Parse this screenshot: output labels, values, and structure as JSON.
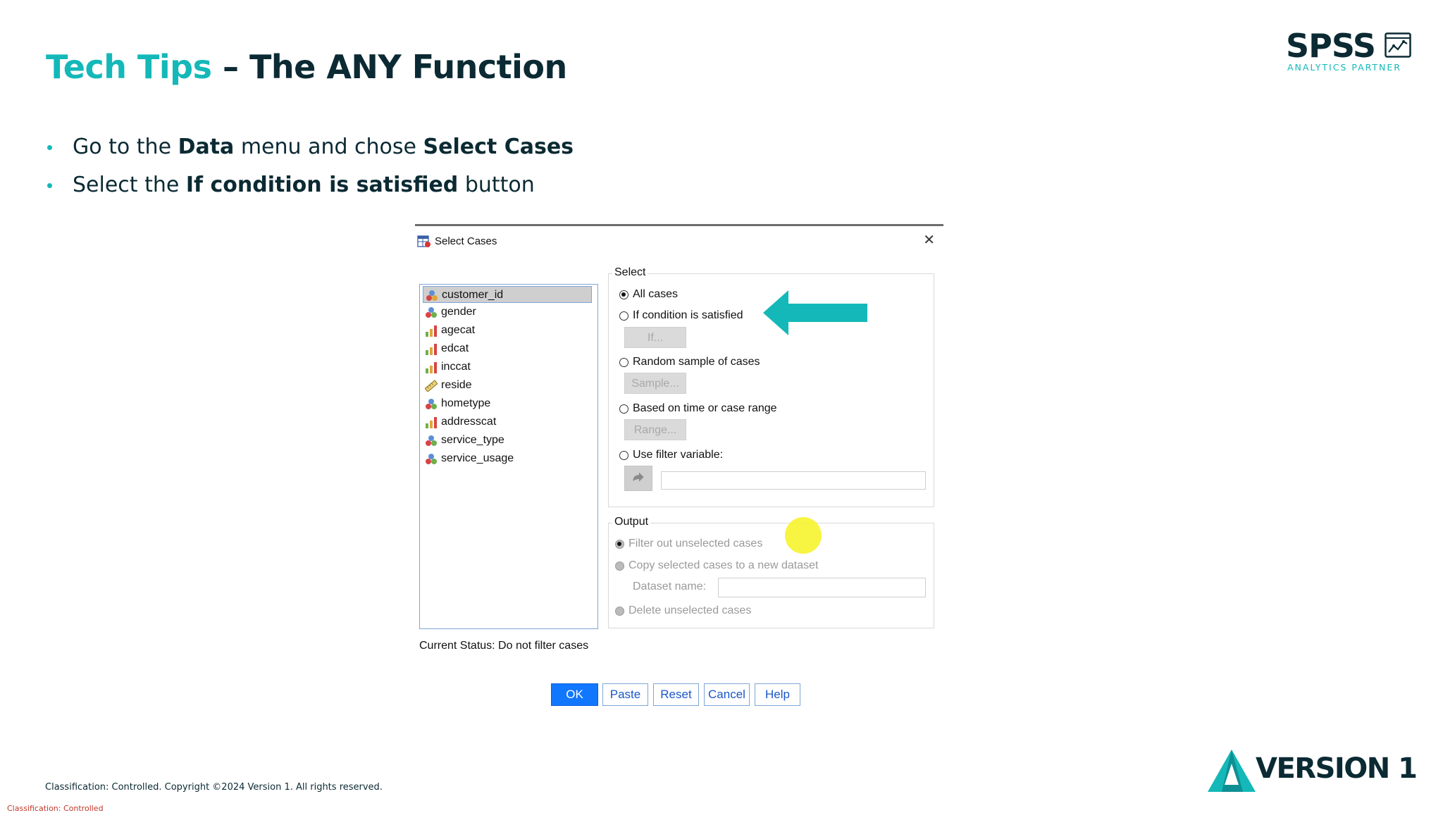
{
  "slide": {
    "title_accent": "Tech Tips",
    "title_rest": " – The ANY Function",
    "bullets": [
      {
        "pre": "Go to the ",
        "b1": "Data",
        "mid": " menu and chose ",
        "b2": "Select Cases",
        "post": ""
      },
      {
        "pre": "Select the ",
        "b1": "If condition is satisfied",
        "mid": " button",
        "b2": "",
        "post": ""
      }
    ],
    "footer": "Classification: Controlled. Copyright ©2024 Version 1. All rights reserved.",
    "classification": "Classification: Controlled",
    "colors": {
      "accent": "#14b8b8",
      "dark": "#0b2a33",
      "highlight": "#f7f221"
    }
  },
  "logos": {
    "spss": {
      "word": "SPSS",
      "sub": "ANALYTICS PARTNER"
    },
    "version1": {
      "word": "VERSION 1"
    }
  },
  "dialog": {
    "title": "Select Cases",
    "close": "✕",
    "variables": [
      {
        "name": "customer_id",
        "icon": "nominal-id-icon"
      },
      {
        "name": "gender",
        "icon": "nominal-icon"
      },
      {
        "name": "agecat",
        "icon": "ordinal-icon"
      },
      {
        "name": "edcat",
        "icon": "ordinal-icon"
      },
      {
        "name": "inccat",
        "icon": "ordinal-icon"
      },
      {
        "name": "reside",
        "icon": "scale-icon"
      },
      {
        "name": "hometype",
        "icon": "nominal-icon"
      },
      {
        "name": "addresscat",
        "icon": "ordinal-icon"
      },
      {
        "name": "service_type",
        "icon": "nominal-icon"
      },
      {
        "name": "service_usage",
        "icon": "nominal-icon"
      }
    ],
    "select_group": {
      "label": "Select",
      "all_cases": "All cases",
      "if_condition": "If condition is satisfied",
      "if_button": "If...",
      "random_sample": "Random sample of cases",
      "sample_button": "Sample...",
      "based_on_time": "Based on time or case range",
      "range_button": "Range...",
      "use_filter": "Use filter variable:"
    },
    "output_group": {
      "label": "Output",
      "filter_out": "Filter out unselected cases",
      "copy_selected": "Copy selected cases to a new dataset",
      "dataset_name": "Dataset name:",
      "delete_unselected": "Delete unselected cases"
    },
    "status": "Current Status: Do not filter cases",
    "buttons": {
      "ok": "OK",
      "paste": "Paste",
      "reset": "Reset",
      "cancel": "Cancel",
      "help": "Help"
    }
  }
}
